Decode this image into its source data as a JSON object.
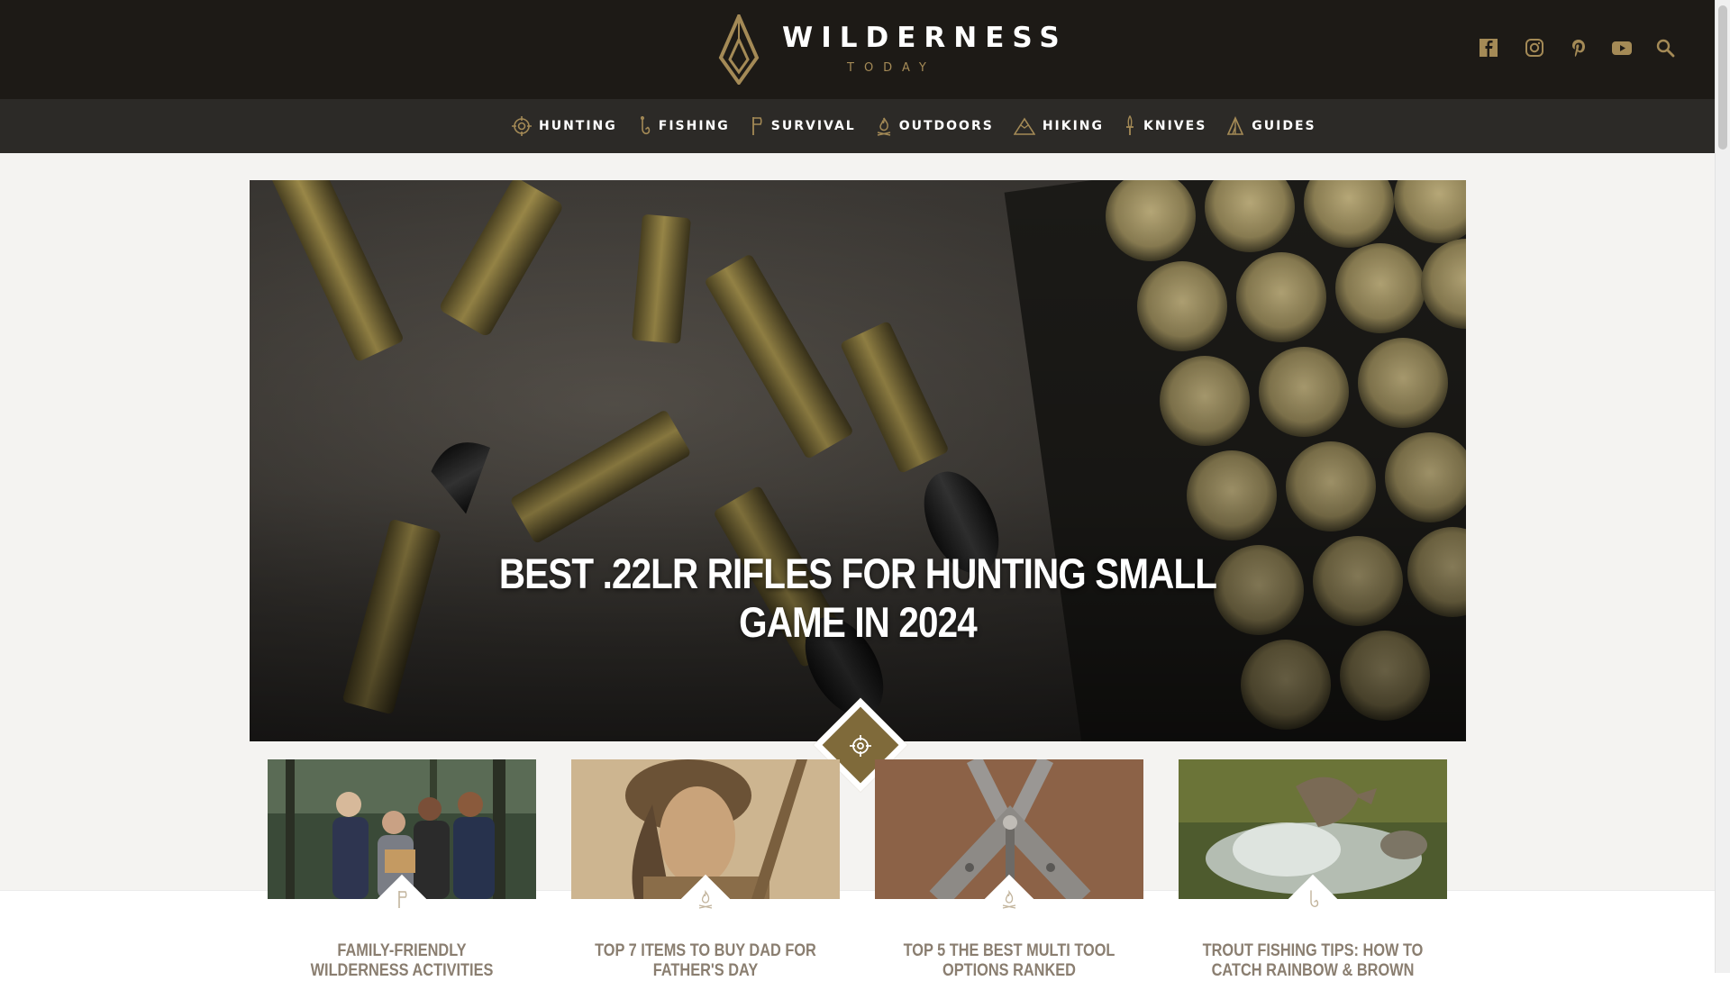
{
  "brand": {
    "name": "WILDERNESS",
    "tagline": "TODAY",
    "accent": "#a48a56",
    "header_bg": "#1d1a16",
    "nav_bg": "#2c2a27"
  },
  "social": [
    {
      "icon": "facebook-icon"
    },
    {
      "icon": "instagram-icon"
    },
    {
      "icon": "pinterest-icon"
    },
    {
      "icon": "youtube-icon"
    },
    {
      "icon": "search-icon"
    }
  ],
  "nav": {
    "items": [
      {
        "label": "HUNTING",
        "icon": "crosshair-icon"
      },
      {
        "label": "FISHING",
        "icon": "fish-hook-icon"
      },
      {
        "label": "SURVIVAL",
        "icon": "axe-icon"
      },
      {
        "label": "OUTDOORS",
        "icon": "campfire-icon"
      },
      {
        "label": "HIKING",
        "icon": "mountain-icon"
      },
      {
        "label": "KNIVES",
        "icon": "knife-icon"
      },
      {
        "label": "GUIDES",
        "icon": "tent-icon"
      }
    ]
  },
  "hero": {
    "title": "BEST .22LR RIFLES FOR HUNTING SMALL GAME IN 2024",
    "category_icon": "crosshair-icon"
  },
  "cards": [
    {
      "title": "FAMILY-FRIENDLY WILDERNESS ACTIVITIES",
      "category_icon": "axe-icon"
    },
    {
      "title": "TOP 7 ITEMS TO BUY DAD FOR FATHER'S DAY",
      "category_icon": "campfire-icon"
    },
    {
      "title": "TOP 5 THE BEST MULTI TOOL OPTIONS RANKED",
      "category_icon": "campfire-icon"
    },
    {
      "title": "TROUT FISHING TIPS: HOW TO CATCH RAINBOW & BROWN",
      "category_icon": "fish-hook-icon"
    }
  ]
}
